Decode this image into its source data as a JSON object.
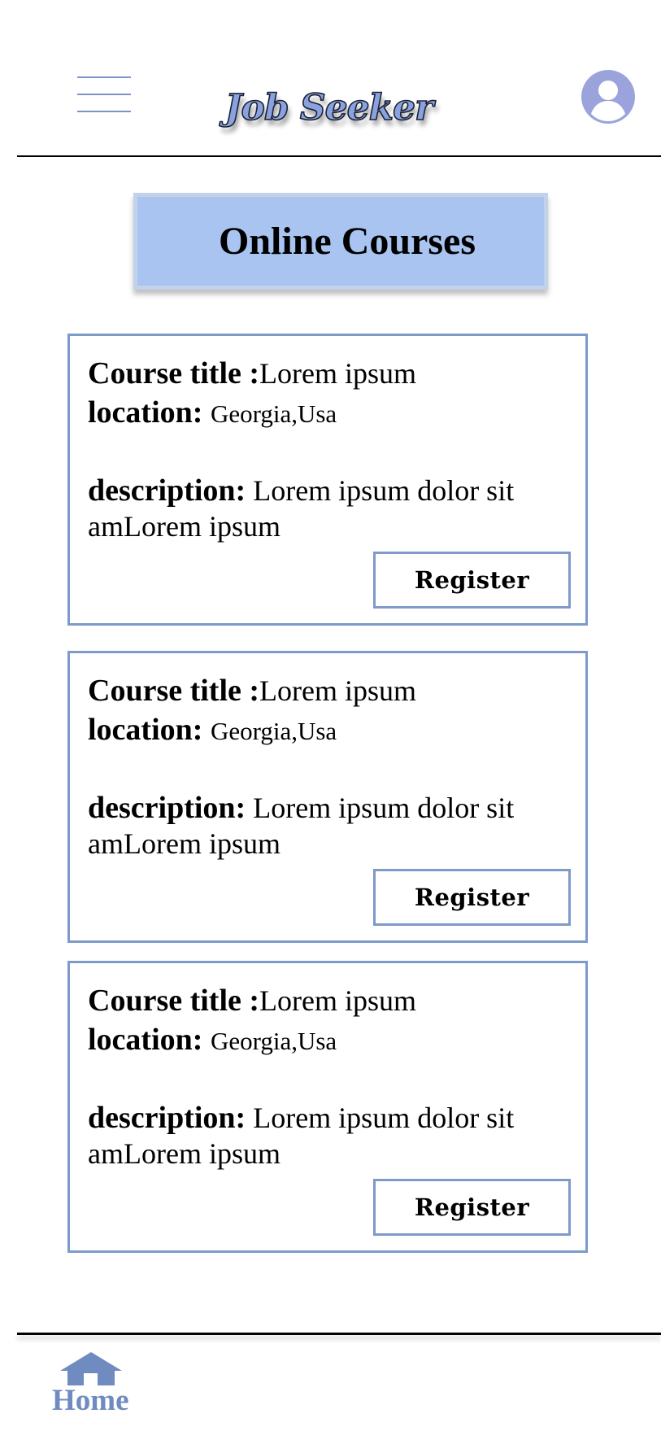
{
  "header": {
    "app_title": "Job Seeker",
    "menu_icon": "hamburger-menu-icon",
    "avatar_icon": "user-avatar-icon"
  },
  "page": {
    "title": "Online Courses"
  },
  "courses": [
    {
      "title_label": "Course title :",
      "title_value": "Lorem ipsum",
      "location_label": "location:",
      "location_value": "Georgia,Usa",
      "description_label": "description:",
      "description_value": "Lorem ipsum dolor sit amLorem ipsum",
      "register_label": "Register"
    },
    {
      "title_label": "Course title :",
      "title_value": "Lorem ipsum",
      "location_label": "location:",
      "location_value": "Georgia,Usa",
      "description_label": "description:",
      "description_value": "Lorem ipsum dolor sit amLorem ipsum",
      "register_label": "Register"
    },
    {
      "title_label": "Course title :",
      "title_value": "Lorem ipsum",
      "location_label": "location:",
      "location_value": "Georgia,Usa",
      "description_label": "description:",
      "description_value": "Lorem ipsum dolor sit amLorem ipsum",
      "register_label": "Register"
    }
  ],
  "footer": {
    "home_label": "Home",
    "home_icon": "home-icon"
  },
  "colors": {
    "accent": "#7d9aca",
    "title_fill": "#a9c4f0",
    "avatar": "#9ba3dc",
    "home": "#6f8bc0"
  }
}
